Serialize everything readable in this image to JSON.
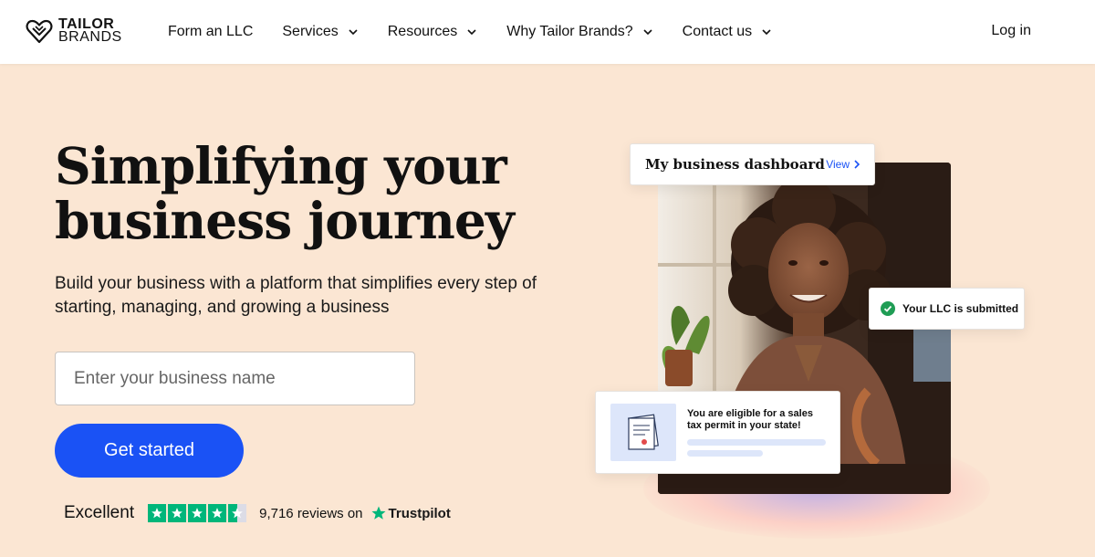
{
  "logo": {
    "line1": "TAILOR",
    "line2": "BRANDS"
  },
  "nav": {
    "items": [
      {
        "label": "Form an LLC",
        "dropdown": false
      },
      {
        "label": "Services",
        "dropdown": true
      },
      {
        "label": "Resources",
        "dropdown": true
      },
      {
        "label": "Why Tailor Brands?",
        "dropdown": true
      },
      {
        "label": "Contact us",
        "dropdown": true
      }
    ],
    "login": "Log in"
  },
  "hero": {
    "title_line1": "Simplifying your",
    "title_line2": "business journey",
    "subtitle": "Build your business with a platform that simplifies every step of starting, managing, and growing a business",
    "input_placeholder": "Enter your business name",
    "cta": "Get started"
  },
  "rating": {
    "label": "Excellent",
    "stars": 4.5,
    "reviews": "9,716 reviews on",
    "provider": "Trustpilot"
  },
  "cards": {
    "dashboard_title": "My business dashboard",
    "dashboard_link": "View",
    "llc_status": "Your LLC is submitted",
    "tax_message": "You are eligible for a sales tax permit in your state!"
  },
  "colors": {
    "accent": "#1a52f5",
    "hero_bg": "#fbe6d3",
    "trustpilot_green": "#00b67a",
    "success_green": "#1f9d55"
  }
}
